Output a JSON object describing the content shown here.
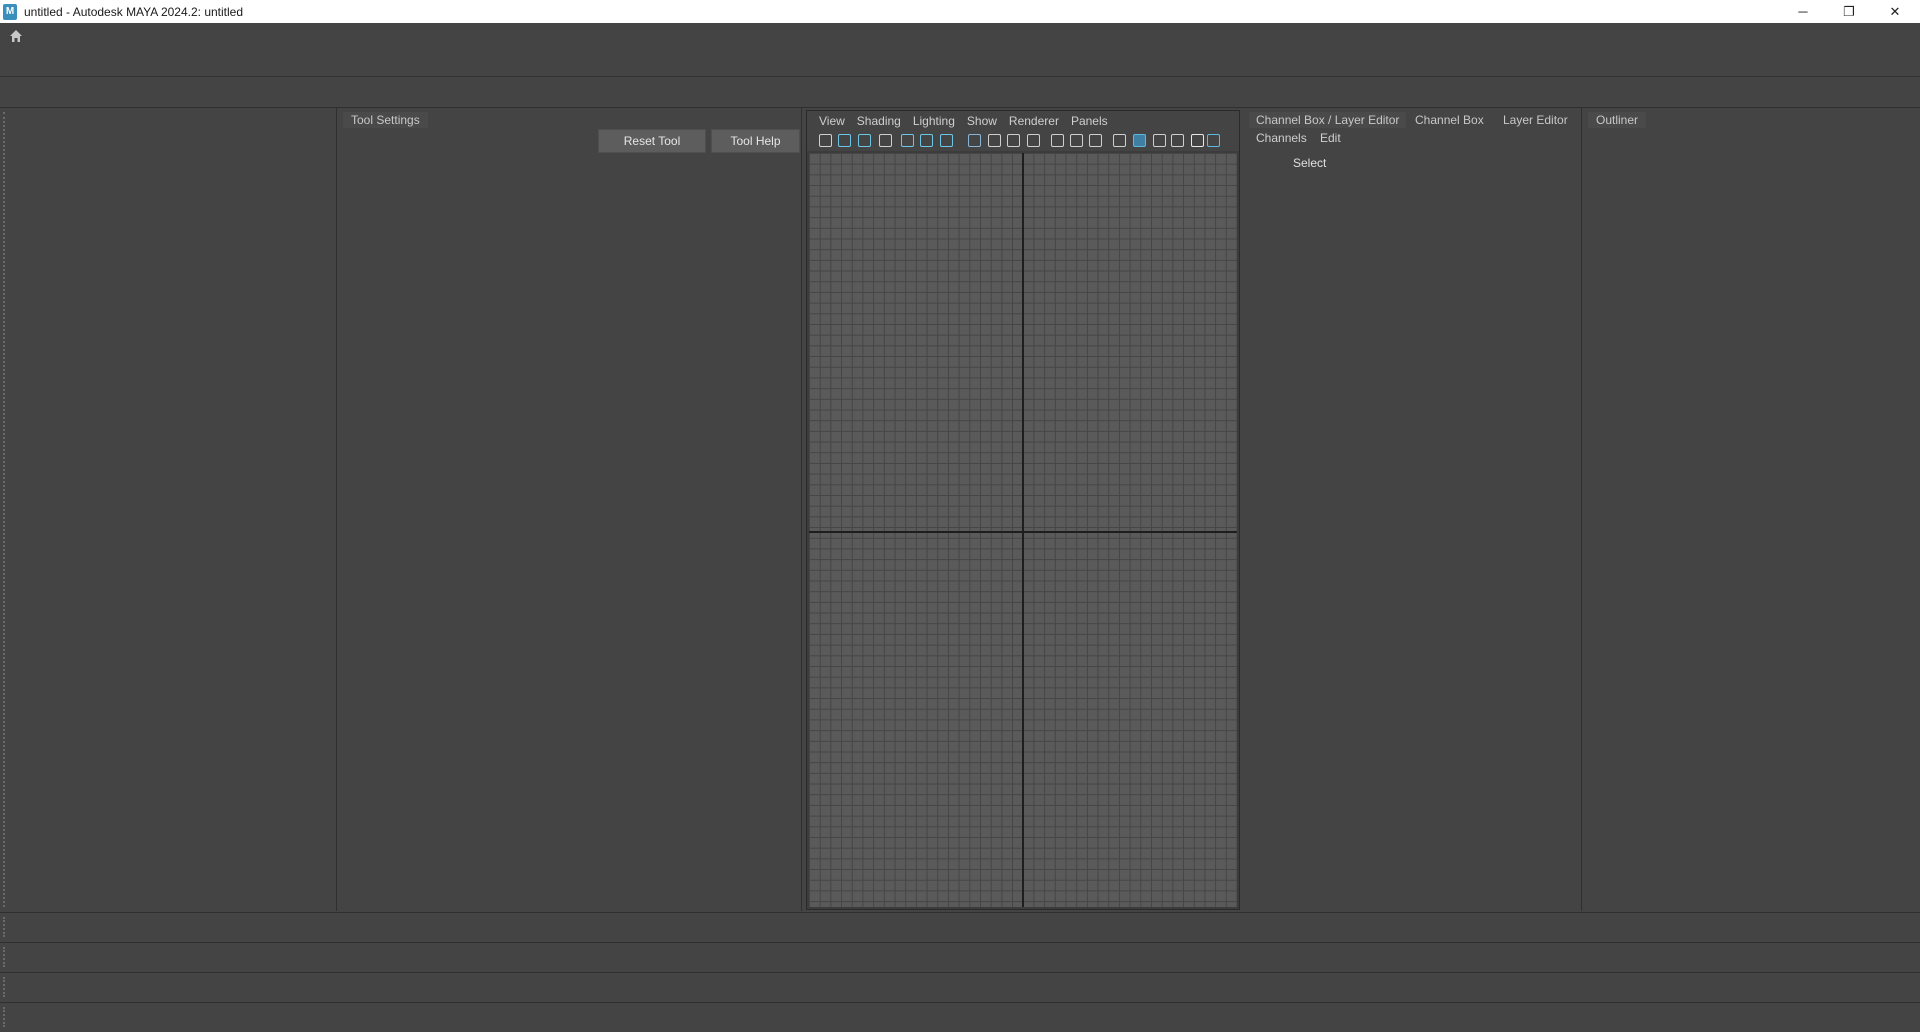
{
  "window": {
    "title": "untitled - Autodesk MAYA 2024.2: untitled",
    "app_icon_letter": "M",
    "controls": {
      "minimize": "─",
      "restore": "❐",
      "close": "✕"
    }
  },
  "tool_settings": {
    "tab_label": "Tool Settings",
    "reset_label": "Reset Tool",
    "help_label": "Tool Help"
  },
  "viewport": {
    "menus": [
      "View",
      "Shading",
      "Lighting",
      "Show",
      "Renderer",
      "Panels"
    ],
    "toolbar_icons": [
      "camera-icon",
      "camera-attributes-icon",
      "bookmark-camera-icon",
      "bookmark-icon",
      "image-plane-icon",
      "2d-pan-zoom-icon",
      "grease-pencil-icon",
      "grid-icon",
      "film-gate-icon",
      "resolution-gate-icon",
      "gate-mask-icon",
      "field-chart-icon",
      "safe-action-icon",
      "safe-title-icon",
      "wireframe-icon",
      "smooth-shade-icon",
      "default-material-icon",
      "textured-icon",
      "use-all-lights-icon",
      "shadows-icon"
    ]
  },
  "channel_box": {
    "tabs": [
      "Channel Box / Layer Editor",
      "Channel Box",
      "Layer Editor"
    ],
    "menus": [
      "Channels",
      "Edit"
    ],
    "select_label": "Select"
  },
  "outliner": {
    "tab_label": "Outliner"
  }
}
